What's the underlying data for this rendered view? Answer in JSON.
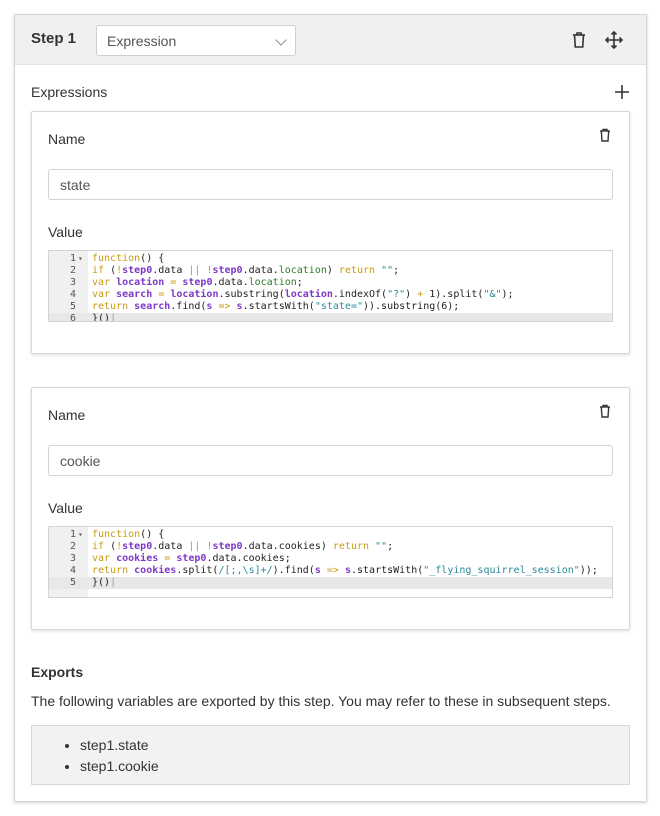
{
  "step": {
    "title": "Step 1",
    "type_value": "Expression"
  },
  "icons": {
    "delete_step": "trash-icon",
    "move_step": "move-icon",
    "add_expression": "plus-icon",
    "delete_expression": "trash-icon",
    "dropdown": "chevron-down-icon"
  },
  "expressions_label": "Expressions",
  "expressions": [
    {
      "name_label": "Name",
      "name_value": "state",
      "value_label": "Value",
      "code": [
        {
          "n": "1",
          "fold": true,
          "active": false,
          "tokens": [
            [
              "function",
              "kw"
            ],
            [
              "() {",
              "plain"
            ]
          ]
        },
        {
          "n": "2",
          "fold": false,
          "active": false,
          "tokens": [
            [
              "if",
              "kw"
            ],
            [
              " (",
              "plain"
            ],
            [
              "!",
              "op"
            ],
            [
              "step0",
              "var"
            ],
            [
              ".data ",
              "plain"
            ],
            [
              "||",
              "op"
            ],
            [
              " ",
              "plain"
            ],
            [
              "!",
              "op"
            ],
            [
              "step0",
              "var"
            ],
            [
              ".data.",
              "plain"
            ],
            [
              "location",
              "fn"
            ],
            [
              ") ",
              "plain"
            ],
            [
              "return",
              "kw"
            ],
            [
              " ",
              "plain"
            ],
            [
              "\"\"",
              "str"
            ],
            [
              ";",
              "plain"
            ]
          ]
        },
        {
          "n": "3",
          "fold": false,
          "active": false,
          "tokens": [
            [
              "var",
              "kw"
            ],
            [
              " ",
              "plain"
            ],
            [
              "location",
              "var"
            ],
            [
              " ",
              "plain"
            ],
            [
              "=",
              "op"
            ],
            [
              " ",
              "plain"
            ],
            [
              "step0",
              "var"
            ],
            [
              ".data.",
              "plain"
            ],
            [
              "location",
              "fn"
            ],
            [
              ";",
              "plain"
            ]
          ]
        },
        {
          "n": "4",
          "fold": false,
          "active": false,
          "tokens": [
            [
              "var",
              "kw"
            ],
            [
              " ",
              "plain"
            ],
            [
              "search",
              "var"
            ],
            [
              " ",
              "plain"
            ],
            [
              "=",
              "op"
            ],
            [
              " ",
              "plain"
            ],
            [
              "location",
              "var"
            ],
            [
              ".substring(",
              "plain"
            ],
            [
              "location",
              "var"
            ],
            [
              ".indexOf(",
              "plain"
            ],
            [
              "\"?\"",
              "str"
            ],
            [
              ") ",
              "plain"
            ],
            [
              "+",
              "op"
            ],
            [
              " 1).split(",
              "plain"
            ],
            [
              "\"&\"",
              "str"
            ],
            [
              ");",
              "plain"
            ]
          ]
        },
        {
          "n": "5",
          "fold": false,
          "active": false,
          "tokens": [
            [
              "return",
              "kw"
            ],
            [
              " ",
              "plain"
            ],
            [
              "search",
              "var"
            ],
            [
              ".find(",
              "plain"
            ],
            [
              "s",
              "var"
            ],
            [
              " ",
              "plain"
            ],
            [
              "=>",
              "op"
            ],
            [
              " ",
              "plain"
            ],
            [
              "s",
              "var"
            ],
            [
              ".startsWith(",
              "plain"
            ],
            [
              "\"state=\"",
              "str"
            ],
            [
              ")).substring(6);",
              "plain"
            ]
          ]
        },
        {
          "n": "6",
          "fold": false,
          "active": true,
          "tokens": [
            [
              "}()",
              "plain"
            ]
          ]
        }
      ]
    },
    {
      "name_label": "Name",
      "name_value": "cookie",
      "value_label": "Value",
      "code": [
        {
          "n": "1",
          "fold": true,
          "active": false,
          "tokens": [
            [
              "function",
              "kw"
            ],
            [
              "() {",
              "plain"
            ]
          ]
        },
        {
          "n": "2",
          "fold": false,
          "active": false,
          "tokens": [
            [
              "if",
              "kw"
            ],
            [
              " (",
              "plain"
            ],
            [
              "!",
              "op"
            ],
            [
              "step0",
              "var"
            ],
            [
              ".data ",
              "plain"
            ],
            [
              "||",
              "op"
            ],
            [
              " ",
              "plain"
            ],
            [
              "!",
              "op"
            ],
            [
              "step0",
              "var"
            ],
            [
              ".data.cookies) ",
              "plain"
            ],
            [
              "return",
              "kw"
            ],
            [
              " ",
              "plain"
            ],
            [
              "\"\"",
              "str"
            ],
            [
              ";",
              "plain"
            ]
          ]
        },
        {
          "n": "3",
          "fold": false,
          "active": false,
          "tokens": [
            [
              "var",
              "kw"
            ],
            [
              " ",
              "plain"
            ],
            [
              "cookies",
              "var"
            ],
            [
              " ",
              "plain"
            ],
            [
              "=",
              "op"
            ],
            [
              " ",
              "plain"
            ],
            [
              "step0",
              "var"
            ],
            [
              ".data.cookies;",
              "plain"
            ]
          ]
        },
        {
          "n": "4",
          "fold": false,
          "active": false,
          "tokens": [
            [
              "return",
              "kw"
            ],
            [
              " ",
              "plain"
            ],
            [
              "cookies",
              "var"
            ],
            [
              ".split(",
              "plain"
            ],
            [
              "/[;,\\s]+/",
              "str"
            ],
            [
              ").find(",
              "plain"
            ],
            [
              "s",
              "var"
            ],
            [
              " ",
              "plain"
            ],
            [
              "=>",
              "op"
            ],
            [
              " ",
              "plain"
            ],
            [
              "s",
              "var"
            ],
            [
              ".startsWith(",
              "plain"
            ],
            [
              "\"_flying_squirrel_session\"",
              "str"
            ],
            [
              "));",
              "plain"
            ]
          ]
        },
        {
          "n": "5",
          "fold": false,
          "active": true,
          "tokens": [
            [
              "}()",
              "plain"
            ]
          ]
        }
      ]
    }
  ],
  "exports": {
    "title": "Exports",
    "description": "The following variables are exported by this step. You may refer to these in subsequent steps.",
    "items": [
      "step1.state",
      "step1.cookie"
    ]
  }
}
